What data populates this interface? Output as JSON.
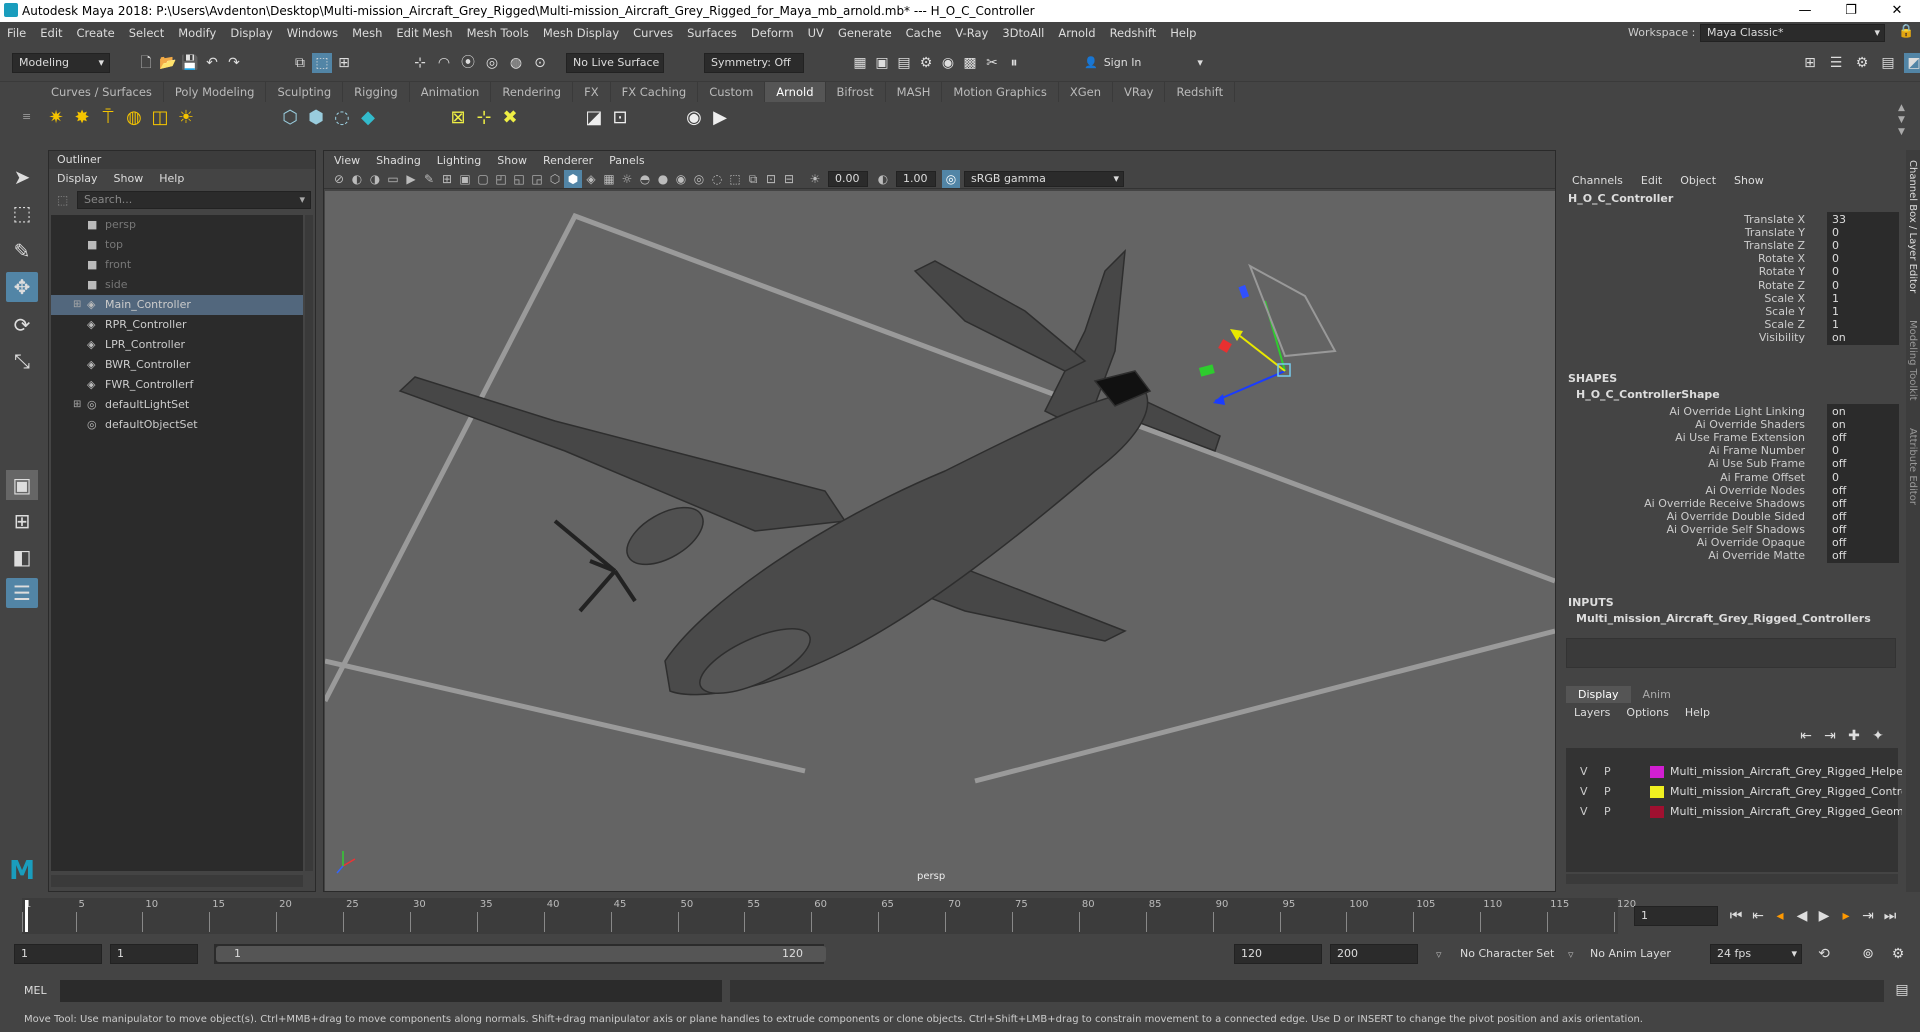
{
  "window": {
    "title": "Autodesk Maya 2018: P:\\Users\\Avdenton\\Desktop\\Multi-mission_Aircraft_Grey_Rigged\\Multi-mission_Aircraft_Grey_Rigged_for_Maya_mb_arnold.mb*   ---   H_O_C_Controller",
    "minimize": "—",
    "maximize": "❐",
    "close": "✕"
  },
  "menubar": {
    "items": [
      "File",
      "Edit",
      "Create",
      "Select",
      "Modify",
      "Display",
      "Windows",
      "Mesh",
      "Edit Mesh",
      "Mesh Tools",
      "Mesh Display",
      "Curves",
      "Surfaces",
      "Deform",
      "UV",
      "Generate",
      "Cache",
      "V-Ray",
      "3DtoAll",
      "Arnold",
      "Redshift",
      "Help"
    ],
    "workspace_label": "Workspace :",
    "workspace_value": "Maya Classic*"
  },
  "statusline": {
    "mode": "Modeling",
    "live_surface": "No Live Surface",
    "symmetry": "Symmetry: Off",
    "sign_in": "Sign In"
  },
  "shelf": {
    "tabs": [
      "Curves / Surfaces",
      "Poly Modeling",
      "Sculpting",
      "Rigging",
      "Animation",
      "Rendering",
      "FX",
      "FX Caching",
      "Custom",
      "Arnold",
      "Bifrost",
      "MASH",
      "Motion Graphics",
      "XGen",
      "VRay",
      "Redshift"
    ],
    "active_tab": "Arnold"
  },
  "outliner": {
    "title": "Outliner",
    "menu": [
      "Display",
      "Show",
      "Help"
    ],
    "search_placeholder": "Search...",
    "items": [
      {
        "label": "persp",
        "dim": true,
        "icon": "camera-icon",
        "expand": false,
        "selected": false
      },
      {
        "label": "top",
        "dim": true,
        "icon": "camera-icon",
        "expand": false,
        "selected": false
      },
      {
        "label": "front",
        "dim": true,
        "icon": "camera-icon",
        "expand": false,
        "selected": false
      },
      {
        "label": "side",
        "dim": true,
        "icon": "camera-icon",
        "expand": false,
        "selected": false
      },
      {
        "label": "Main_Controller",
        "dim": false,
        "icon": "curve-icon",
        "expand": true,
        "selected": true
      },
      {
        "label": "RPR_Controller",
        "dim": false,
        "icon": "curve-icon",
        "expand": false,
        "selected": false
      },
      {
        "label": "LPR_Controller",
        "dim": false,
        "icon": "curve-icon",
        "expand": false,
        "selected": false
      },
      {
        "label": "BWR_Controller",
        "dim": false,
        "icon": "curve-icon",
        "expand": false,
        "selected": false
      },
      {
        "label": "FWR_Controllerf",
        "dim": false,
        "icon": "curve-icon",
        "expand": false,
        "selected": false
      },
      {
        "label": "defaultLightSet",
        "dim": false,
        "icon": "set-icon",
        "expand": true,
        "selected": false
      },
      {
        "label": "defaultObjectSet",
        "dim": false,
        "icon": "set-icon",
        "expand": false,
        "selected": false
      }
    ]
  },
  "viewport": {
    "menu": [
      "View",
      "Shading",
      "Lighting",
      "Show",
      "Renderer",
      "Panels"
    ],
    "exposure": "0.00",
    "gamma": "1.00",
    "color_space": "sRGB gamma",
    "camera_label": "persp"
  },
  "channelbox": {
    "menu": [
      "Channels",
      "Edit",
      "Object",
      "Show"
    ],
    "node": "H_O_C_Controller",
    "attributes": [
      {
        "name": "Translate X",
        "value": "33"
      },
      {
        "name": "Translate Y",
        "value": "0"
      },
      {
        "name": "Translate Z",
        "value": "0"
      },
      {
        "name": "Rotate X",
        "value": "0"
      },
      {
        "name": "Rotate Y",
        "value": "0"
      },
      {
        "name": "Rotate Z",
        "value": "0"
      },
      {
        "name": "Scale X",
        "value": "1"
      },
      {
        "name": "Scale Y",
        "value": "1"
      },
      {
        "name": "Scale Z",
        "value": "1"
      },
      {
        "name": "Visibility",
        "value": "on"
      }
    ],
    "shapes_header": "SHAPES",
    "shape_node": "H_O_C_ControllerShape",
    "shape_attributes": [
      {
        "name": "Ai Override Light Linking",
        "value": "on"
      },
      {
        "name": "Ai Override Shaders",
        "value": "on"
      },
      {
        "name": "Ai Use Frame Extension",
        "value": "off"
      },
      {
        "name": "Ai Frame Number",
        "value": "0"
      },
      {
        "name": "Ai Use Sub Frame",
        "value": "off"
      },
      {
        "name": "Ai Frame Offset",
        "value": "0"
      },
      {
        "name": "Ai Override Nodes",
        "value": "off"
      },
      {
        "name": "Ai Override Receive Shadows",
        "value": "off"
      },
      {
        "name": "Ai Override Double Sided",
        "value": "off"
      },
      {
        "name": "Ai Override Self Shadows",
        "value": "off"
      },
      {
        "name": "Ai Override Opaque",
        "value": "off"
      },
      {
        "name": "Ai Override Matte",
        "value": "off"
      }
    ],
    "inputs_header": "INPUTS",
    "input_node": "Multi_mission_Aircraft_Grey_Rigged_Controllers",
    "side_tabs": [
      "Channel Box / Layer Editor",
      "Modeling Toolkit",
      "Attribute Editor"
    ]
  },
  "layers": {
    "tabs": [
      "Display",
      "Anim"
    ],
    "menu": [
      "Layers",
      "Options",
      "Help"
    ],
    "items": [
      {
        "v": "V",
        "p": "P",
        "color": "#d21fd2",
        "name": "Multi_mission_Aircraft_Grey_Rigged_Helpers"
      },
      {
        "v": "V",
        "p": "P",
        "color": "#f0f020",
        "name": "Multi_mission_Aircraft_Grey_Rigged_Controllers"
      },
      {
        "v": "V",
        "p": "P",
        "color": "#a01030",
        "name": "Multi_mission_Aircraft_Grey_Rigged_Geometry"
      }
    ]
  },
  "timeline": {
    "ticks": [
      "1",
      "5",
      "10",
      "15",
      "20",
      "25",
      "30",
      "35",
      "40",
      "45",
      "50",
      "55",
      "60",
      "65",
      "70",
      "75",
      "80",
      "85",
      "90",
      "95",
      "100",
      "105",
      "110",
      "115",
      "120"
    ],
    "current_frame": "1"
  },
  "range": {
    "start": "1",
    "playback_start": "1",
    "slider_start": "1",
    "slider_end": "120",
    "playback_end": "120",
    "end": "200",
    "character_set": "No Character Set",
    "anim_layer": "No Anim Layer",
    "fps": "24 fps"
  },
  "mel": {
    "label": "MEL"
  },
  "helpline": {
    "text": "Move Tool: Use manipulator to move object(s). Ctrl+MMB+drag to move components along normals. Shift+drag manipulator axis or plane handles to extrude components or clone objects. Ctrl+Shift+LMB+drag to constrain movement to a connected edge. Use D or INSERT to change the pivot position and axis orientation."
  },
  "colors": {
    "accent": "#5285a6",
    "selection": "#52677d",
    "viewport_bg": "#646464"
  }
}
